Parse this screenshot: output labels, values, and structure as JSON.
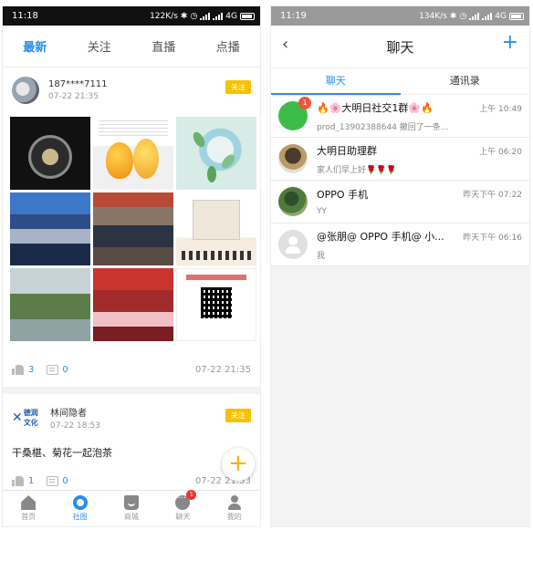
{
  "left": {
    "status": {
      "time": "11:18",
      "speed": "122K/s",
      "network": "4G"
    },
    "tabs": [
      {
        "label": "最新",
        "active": true
      },
      {
        "label": "关注",
        "active": false
      },
      {
        "label": "直播",
        "active": false
      },
      {
        "label": "点播",
        "active": false
      }
    ],
    "post1": {
      "user": "187****7111",
      "time": "07-22 21:35",
      "follow": "关注",
      "likes": "3",
      "comments": "0",
      "date": "07-22 21:35"
    },
    "post2": {
      "user": "林间隐者",
      "time": "07-22 18:53",
      "follow": "关注",
      "text": "干桑椹、菊花一起泡茶",
      "likes": "1",
      "comments": "0",
      "date": "07-22 21:53"
    },
    "bottom_nav": [
      {
        "label": "首页",
        "icon": "home-icon"
      },
      {
        "label": "社图",
        "icon": "community-icon",
        "active": true
      },
      {
        "label": "商城",
        "icon": "shop-icon"
      },
      {
        "label": "聊天",
        "icon": "chat-icon",
        "badge": "1"
      },
      {
        "label": "我的",
        "icon": "profile-icon"
      }
    ],
    "fab": "+"
  },
  "right": {
    "status": {
      "time": "11:19",
      "speed": "134K/s",
      "network": "4G"
    },
    "title": "聊天",
    "back": "‹",
    "plus": "+",
    "subtabs": [
      {
        "label": "聊天",
        "active": true
      },
      {
        "label": "通讯录",
        "active": false
      }
    ],
    "chats": [
      {
        "name": "🔥🌸大明日社交1群🌸🔥",
        "preview": "prod_13902388644 撤回了一条...",
        "time": "上午 10:49",
        "badge": "1",
        "avatar": "green"
      },
      {
        "name": "大明日助理群",
        "preview": "家人们早上好🌹🌹🌹",
        "time": "上午 06:20",
        "avatar": "group"
      },
      {
        "name": "OPPO 手机",
        "preview": "YY",
        "time": "昨天下午 07:22",
        "avatar": "oppo"
      },
      {
        "name": "@张朋@ OPPO 手机@ 小...",
        "preview": "我",
        "time": "昨天下午 06:16",
        "avatar": "default"
      }
    ]
  },
  "colors": {
    "accent": "#2a8ee6",
    "follow": "#f7c100",
    "badge": "#f0543a"
  }
}
